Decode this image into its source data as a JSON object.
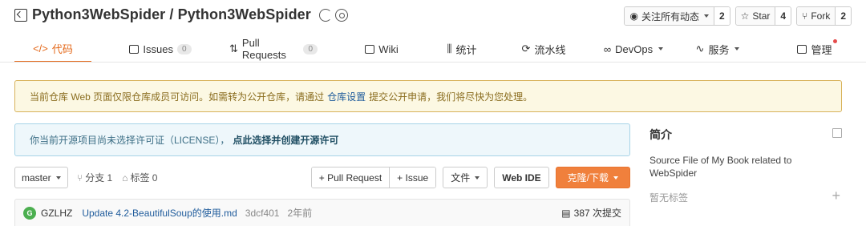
{
  "repo": {
    "title": "Python3WebSpider / Python3WebSpider",
    "actions": [
      {
        "label": "关注所有动态",
        "count": "2",
        "icon": "eye-icon",
        "dropdown": true
      },
      {
        "label": "Star",
        "count": "4",
        "icon": "star-icon",
        "dropdown": false
      },
      {
        "label": "Fork",
        "count": "2",
        "icon": "fork-icon",
        "dropdown": false
      }
    ]
  },
  "tabs": [
    {
      "label": "代码",
      "icon": "code-icon",
      "badge": null,
      "active": true
    },
    {
      "label": "Issues",
      "icon": "issues-icon",
      "badge": "0",
      "active": false
    },
    {
      "label": "Pull Requests",
      "icon": "pull-request-icon",
      "badge": "0",
      "active": false
    },
    {
      "label": "Wiki",
      "icon": "wiki-icon",
      "badge": null,
      "active": false
    },
    {
      "label": "统计",
      "icon": "chart-icon",
      "badge": null,
      "active": false
    },
    {
      "label": "流水线",
      "icon": "pipeline-icon",
      "badge": null,
      "active": false
    },
    {
      "label": "DevOps",
      "icon": "infinity-icon",
      "badge": null,
      "active": false
    },
    {
      "label": "服务",
      "icon": "pulse-icon",
      "badge": null,
      "active": false
    },
    {
      "label": "管理",
      "icon": "settings-icon",
      "badge": null,
      "active": false
    }
  ],
  "notice": {
    "before": "当前仓库 Web 页面仅限仓库成员可访问。如需转为公开仓库，请通过",
    "link": "仓库设置",
    "after": "提交公开申请，我们将尽快为您处理。"
  },
  "license": {
    "text": "你当前开源项目尚未选择许可证（LICENSE），",
    "link": "点此选择并创建开源许可"
  },
  "toolbar": {
    "branch": "master",
    "branches": "分支 1",
    "tags": "标签 0",
    "pull_request": "+ Pull Request",
    "issue": "+ Issue",
    "files": "文件",
    "web_ide": "Web IDE",
    "clone": "克隆/下载"
  },
  "commit": {
    "avatar": "G",
    "author": "GZLHZ",
    "message": "Update 4.2-BeautifulSoup的使用.md",
    "sha": "3dcf401",
    "time": "2年前",
    "count": "387 次提交"
  },
  "sidebar": {
    "title": "简介",
    "description": "Source File of My Book related to WebSpider",
    "tags": "暂无标签"
  },
  "colors": {
    "accent": "#e4691b",
    "link": "#205c9c",
    "notice_bg": "#fcf8e3",
    "license_bg": "#eef7fb",
    "clone_button": "#f0803c"
  }
}
